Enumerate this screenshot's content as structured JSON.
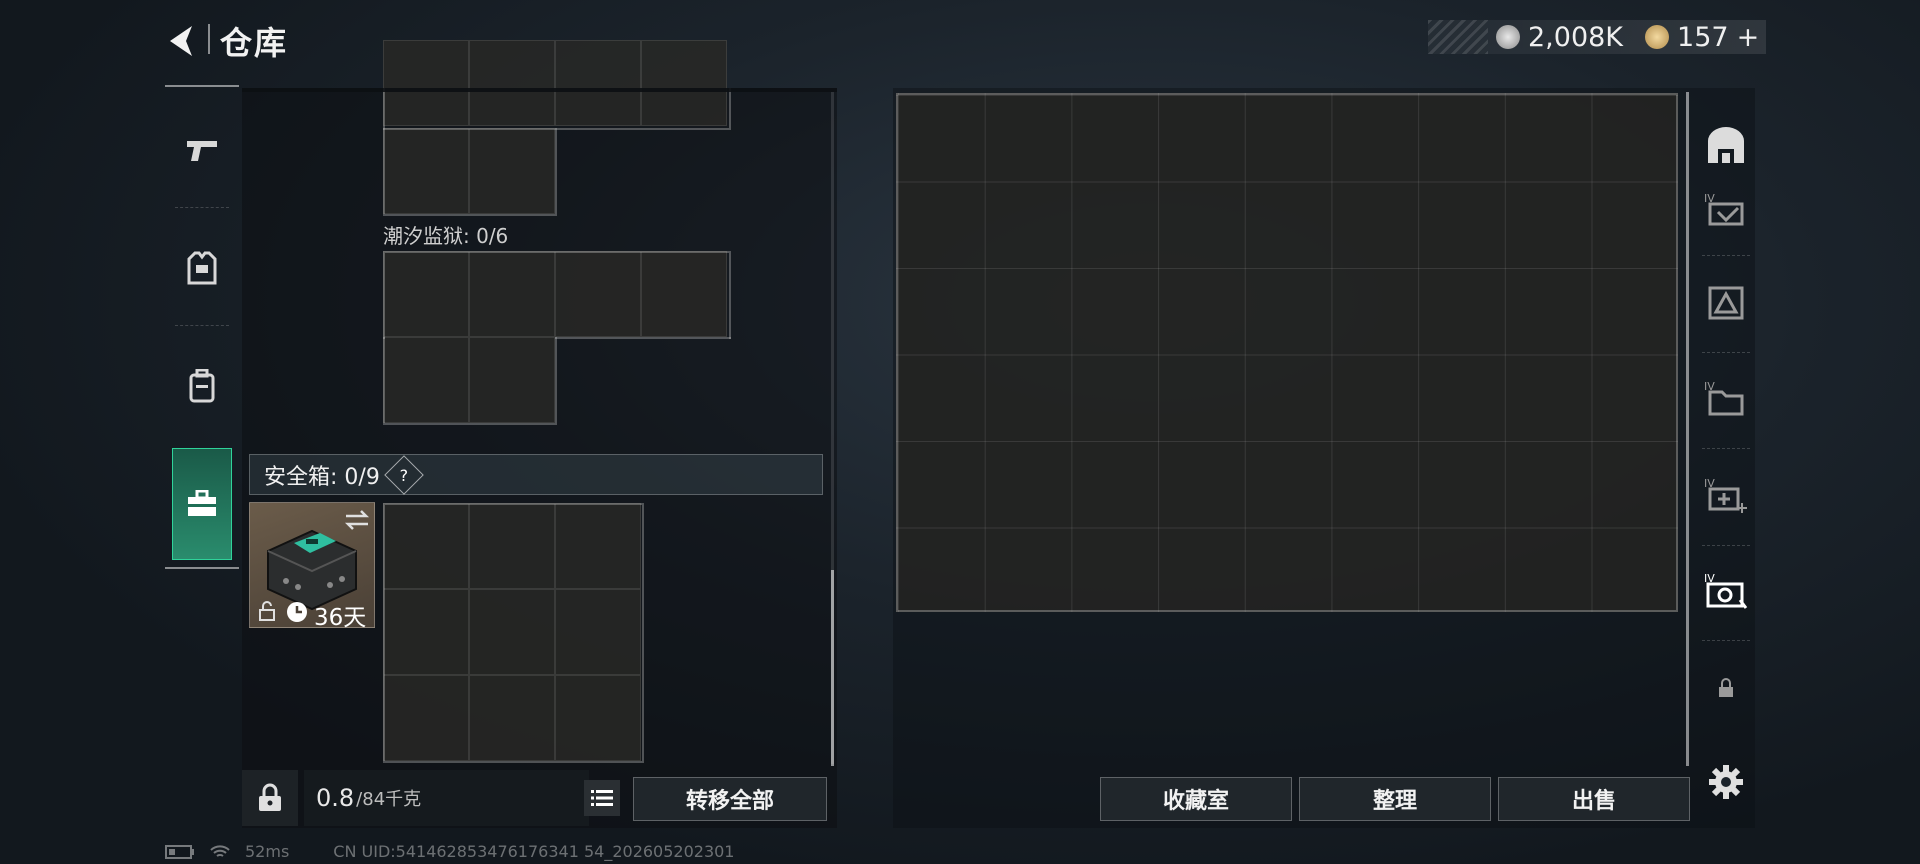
{
  "header": {
    "title": "仓库",
    "currency_a": "2,008K",
    "currency_b": "157",
    "plus": "+"
  },
  "left_panel": {
    "tide_prison_label": "潮汐监狱: 0/6",
    "safebox_label": "安全箱: 0/9",
    "help": "?",
    "case_days": "36天",
    "weight_value": "0.8",
    "weight_max": "/84千克",
    "transfer_all": "转移全部"
  },
  "right_panel": {
    "buttons": {
      "collection": "收藏室",
      "sort": "整理",
      "sell": "出售"
    }
  },
  "status_bar": {
    "ping": "52ms",
    "uid": "CN UID:541462853476176341 54_202605202301"
  },
  "colors": {
    "accent_green": "#2fd39a",
    "case_bg": "#6b5c4a"
  }
}
